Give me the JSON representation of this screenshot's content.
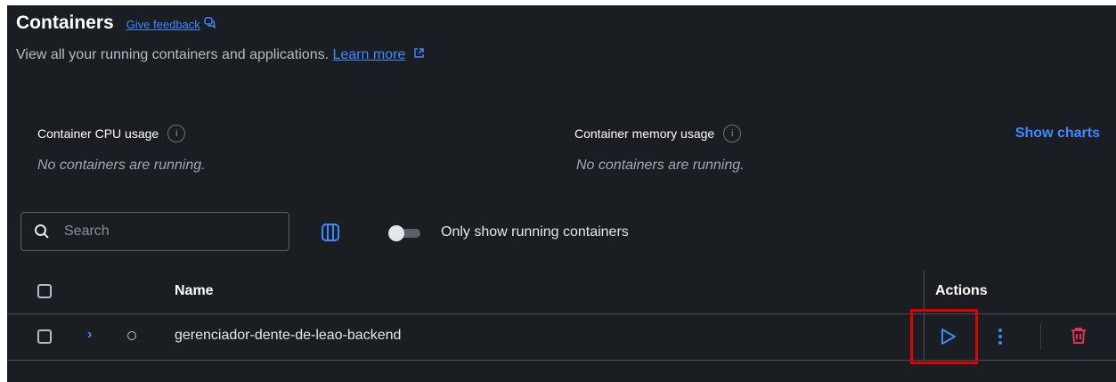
{
  "header": {
    "title": "Containers",
    "feedback_link": "Give feedback",
    "subtitle": "View all your running containers and applications.",
    "learn_more": "Learn more"
  },
  "metrics": {
    "cpu_label": "Container CPU usage",
    "cpu_empty": "No containers are running.",
    "memory_label": "Container memory usage",
    "memory_empty": "No containers are running.",
    "show_charts": "Show charts"
  },
  "toolbar": {
    "search_placeholder": "Search",
    "toggle_label": "Only show running containers",
    "toggle_on": false
  },
  "table": {
    "columns": {
      "name": "Name",
      "actions": "Actions"
    },
    "rows": [
      {
        "name": "gerenciador-dente-de-leao-backend",
        "status": "stopped"
      }
    ]
  },
  "icons": [
    "feedback-icon",
    "external-link-icon",
    "info-icon",
    "search-icon",
    "columns-icon",
    "chevron-right-icon",
    "status-icon",
    "play-icon",
    "kebab-menu-icon",
    "trash-icon"
  ],
  "colors": {
    "background": "#1a1d21",
    "accent": "#3b8bff",
    "danger": "#e2315a",
    "highlight": "#e00000"
  }
}
